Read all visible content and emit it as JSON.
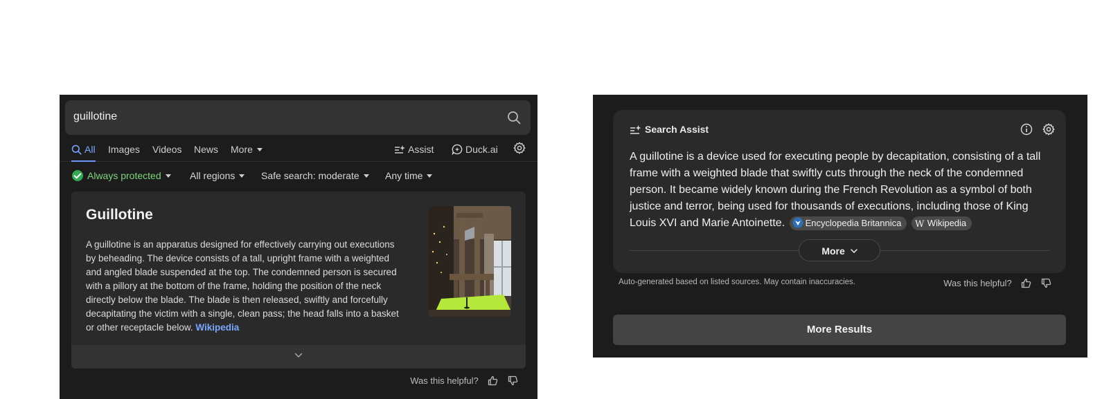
{
  "search": {
    "query": "guillotine"
  },
  "tabs": [
    {
      "label": "All"
    },
    {
      "label": "Images"
    },
    {
      "label": "Videos"
    },
    {
      "label": "News"
    },
    {
      "label": "More"
    }
  ],
  "tools": {
    "assist_label": "Assist",
    "duckai_label": "Duck.ai"
  },
  "filters": {
    "protection": "Always protected",
    "region": "All regions",
    "safe_search": "Safe search: moderate",
    "time": "Any time"
  },
  "knowledge_card": {
    "title": "Guillotine",
    "body": "A guillotine is an apparatus designed for effectively carrying out executions by beheading. The device consists of a tall, upright frame with a weighted and angled blade suspended at the top. The condemned person is secured with a pillory at the bottom of the frame, holding the position of the neck directly below the blade. The blade is then released, swiftly and forcefully decapitating the victim with a single, clean pass; the head falls into a basket or other receptacle below.",
    "source_link": "Wikipedia"
  },
  "feedback": {
    "label": "Was this helpful?"
  },
  "search_assist": {
    "heading": "Search Assist",
    "text": "A guillotine is a device used for executing people by decapitation, consisting of a tall frame with a weighted blade that swiftly cuts through the neck of the condemned person. It became widely known during the French Revolution as a symbol of both justice and terror, being used for thousands of executions, including those of King Louis XVI and Marie Antoinette.",
    "sources": [
      "Encyclopedia Britannica",
      "Wikipedia"
    ],
    "more_label": "More",
    "disclaimer": "Auto-generated based on listed sources. May contain inaccuracies."
  },
  "more_results_label": "More Results",
  "colors": {
    "accent": "#7aa7ff",
    "protected_green": "#35a853",
    "panel_bg": "#1c1c1c",
    "card_bg": "#2a2a2a"
  },
  "icons": [
    "search-icon",
    "sparkle-icon",
    "duckai-chat-icon",
    "gear-icon",
    "check-circle-icon",
    "chevron-down-icon",
    "thumbs-up-icon",
    "thumbs-down-icon",
    "info-icon",
    "britannica-icon",
    "wikipedia-icon"
  ]
}
